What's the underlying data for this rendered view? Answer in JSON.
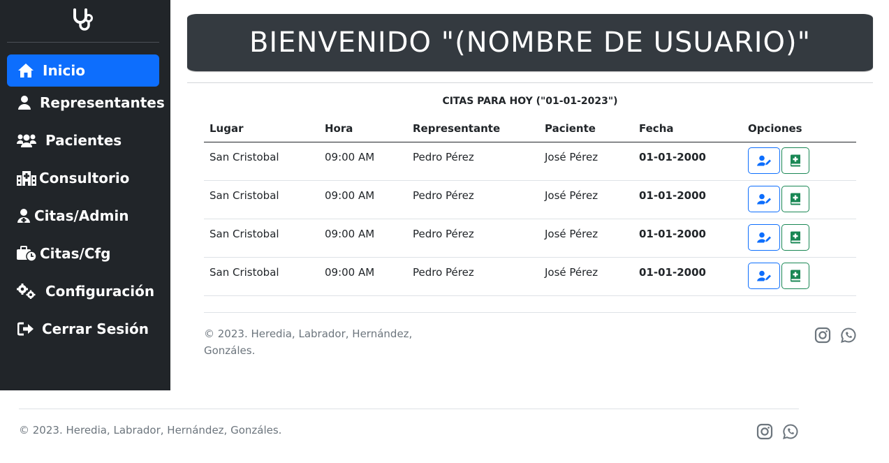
{
  "sidebar": {
    "logo_icon": "stethoscope-icon",
    "items": [
      {
        "label": "Inicio",
        "icon": "home-icon",
        "active": true
      },
      {
        "label": "Representantes",
        "icon": "user-icon"
      },
      {
        "label": "Pacientes",
        "icon": "users-icon"
      },
      {
        "label": "Consultorio",
        "icon": "hospital-icon"
      },
      {
        "label": "Citas/Admin",
        "icon": "user-doctor-icon"
      },
      {
        "label": "Citas/Cfg",
        "icon": "briefcase-clock-icon"
      },
      {
        "label": "Configuración",
        "icon": "gears-icon"
      },
      {
        "label": "Cerrar Sesión",
        "icon": "sign-out-icon"
      }
    ]
  },
  "banner": {
    "title": "BIENVENIDO \"(NOMBRE DE USUARIO)\""
  },
  "appointments": {
    "caption": "CITAS PARA HOY (\"01-01-2023\")",
    "headers": {
      "place": "Lugar",
      "time": "Hora",
      "representative": "Representante",
      "patient": "Paciente",
      "date": "Fecha",
      "options": "Opciones"
    },
    "rows": [
      {
        "place": "San Cristobal",
        "time": "09:00 AM",
        "representative": "Pedro Pérez",
        "patient": "José Pérez",
        "date": "01-01-2000"
      },
      {
        "place": "San Cristobal",
        "time": "09:00 AM",
        "representative": "Pedro Pérez",
        "patient": "José Pérez",
        "date": "01-01-2000"
      },
      {
        "place": "San Cristobal",
        "time": "09:00 AM",
        "representative": "Pedro Pérez",
        "patient": "José Pérez",
        "date": "01-01-2000"
      },
      {
        "place": "San Cristobal",
        "time": "09:00 AM",
        "representative": "Pedro Pérez",
        "patient": "José Pérez",
        "date": "01-01-2000"
      }
    ],
    "option_icons": [
      "user-edit-icon",
      "book-medical-icon"
    ]
  },
  "inner_footer": {
    "copyright": "© 2023. Heredia, Labrador, Hernández, Gonzáles.",
    "social_icons": [
      "instagram-icon",
      "whatsapp-icon"
    ]
  },
  "outer_footer": {
    "copyright": "© 2023. Heredia, Labrador, Hernández, Gonzáles.",
    "social_icons": [
      "instagram-icon",
      "whatsapp-icon"
    ]
  },
  "colors": {
    "sidebar_bg": "#212529",
    "active": "#0d6efd",
    "banner_bg": "#343a40",
    "primary": "#0d6efd",
    "success": "#198754",
    "muted": "#6c757d"
  }
}
